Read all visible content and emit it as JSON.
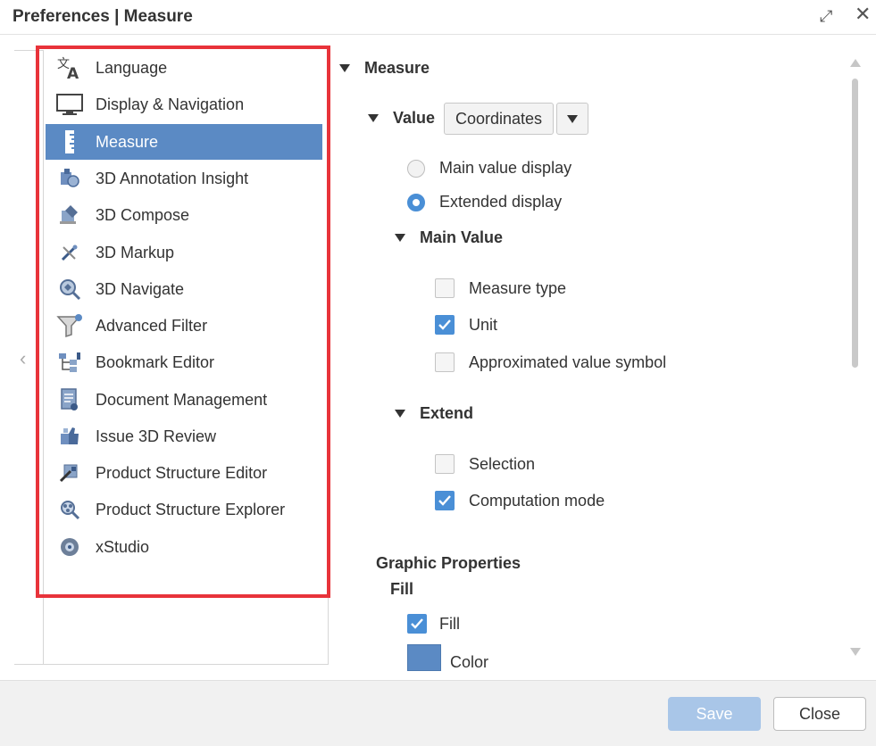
{
  "window": {
    "title": "Preferences | Measure"
  },
  "sidebar": {
    "items": [
      {
        "label": "Language",
        "icon": "language-icon"
      },
      {
        "label": "Display & Navigation",
        "icon": "monitor-icon"
      },
      {
        "label": "Measure",
        "icon": "ruler-icon",
        "active": true
      },
      {
        "label": "3D Annotation Insight",
        "icon": "annotation-insight-icon"
      },
      {
        "label": "3D Compose",
        "icon": "compose-icon"
      },
      {
        "label": "3D Markup",
        "icon": "markup-icon"
      },
      {
        "label": "3D Navigate",
        "icon": "navigate-icon"
      },
      {
        "label": "Advanced Filter",
        "icon": "filter-icon"
      },
      {
        "label": "Bookmark Editor",
        "icon": "bookmark-editor-icon"
      },
      {
        "label": "Document Management",
        "icon": "document-management-icon"
      },
      {
        "label": "Issue 3D Review",
        "icon": "issue-review-icon"
      },
      {
        "label": "Product Structure Editor",
        "icon": "structure-editor-icon"
      },
      {
        "label": "Product Structure Explorer",
        "icon": "structure-explorer-icon"
      },
      {
        "label": "xStudio",
        "icon": "xstudio-icon"
      }
    ]
  },
  "content": {
    "section_title": "Measure",
    "value_label": "Value",
    "value_selected": "Coordinates",
    "radio_main": "Main value display",
    "radio_extended": "Extended display",
    "main_value_title": "Main Value",
    "measure_type": "Measure type",
    "unit": "Unit",
    "approx_symbol": "Approximated value symbol",
    "extend_title": "Extend",
    "selection": "Selection",
    "computation_mode": "Computation mode",
    "graphic_properties": "Graphic Properties",
    "fill_title": "Fill",
    "fill_checkbox": "Fill",
    "color_label": "Color",
    "fill_color": "#5b8ac4"
  },
  "footer": {
    "save_label": "Save",
    "close_label": "Close"
  },
  "colors": {
    "accent": "#5b8ac4",
    "highlight_border": "#e8333a",
    "checkbox_on": "#4a8fd6"
  }
}
